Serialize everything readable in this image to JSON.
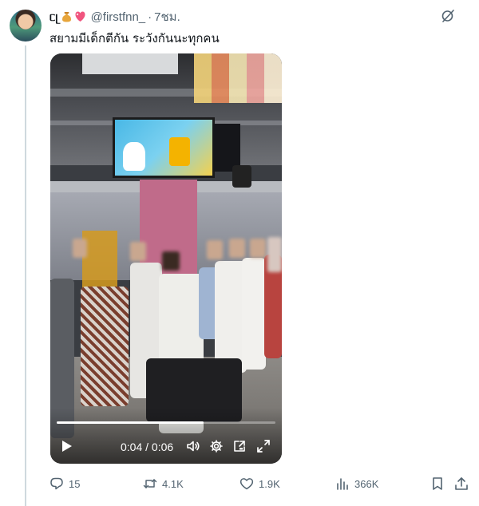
{
  "tweet": {
    "display_name": "ᥴᥨ",
    "display_emojis": [
      "money-bag-emoji",
      "sparkling-heart-emoji"
    ],
    "handle": "@firstfnn_",
    "separator": "·",
    "time": "7ชม.",
    "text": "สยามมีเด็กตีกัน ระวังกันนะทุกคน"
  },
  "video": {
    "current_time": "0:04",
    "time_separator": "/",
    "duration": "0:06",
    "progress": 0.67,
    "controls": [
      "play-icon",
      "volume-icon",
      "settings-gear-icon",
      "pip-icon",
      "fullscreen-icon"
    ]
  },
  "actions": {
    "replies": "15",
    "reposts": "4.1K",
    "likes": "1.9K",
    "views": "366K",
    "icons": [
      "reply-icon",
      "repost-icon",
      "like-icon",
      "views-icon",
      "bookmark-icon",
      "share-icon"
    ]
  },
  "colors": {
    "text_primary": "#0f1419",
    "text_secondary": "#536471",
    "heart_emoji": "#f0547e",
    "bag_emoji": "#e7a53b"
  }
}
